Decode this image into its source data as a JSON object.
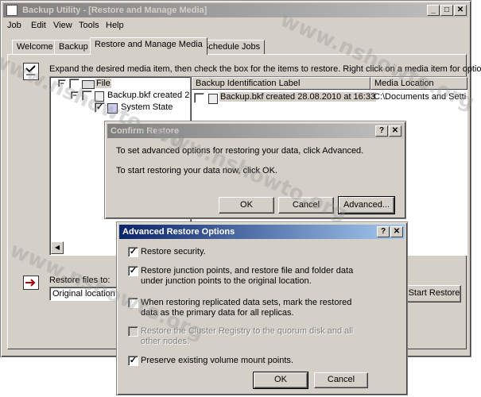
{
  "main_window": {
    "title": "Backup Utility - [Restore and Manage Media]",
    "menu": [
      "Job",
      "Edit",
      "View",
      "Tools",
      "Help"
    ],
    "tabs": [
      "Welcome",
      "Backup",
      "Restore and Manage Media",
      "Schedule Jobs"
    ],
    "instruction": "Expand the desired media item, then check the box for the items to restore. Right click on a media item for options:",
    "tree": {
      "root": "File",
      "child": "Backup.bkf created 2",
      "grandchild": "System State"
    },
    "list": {
      "columns": [
        "Backup Identification Label",
        "Media Location"
      ],
      "rows": [
        {
          "label": "Backup.bkf created 28.08.2010 at 16:33",
          "location": "C:\\Documents and Settin"
        }
      ]
    },
    "restore_files_to_label": "Restore files to:",
    "restore_files_to_value": "Original location",
    "start_restore_label": "Start Restore"
  },
  "confirm_dialog": {
    "title": "Confirm Restore",
    "line1": "To set advanced options for restoring your data, click Advanced.",
    "line2": "To start restoring your data now, click OK.",
    "ok": "OK",
    "cancel": "Cancel",
    "advanced": "Advanced..."
  },
  "advanced_dialog": {
    "title": "Advanced Restore Options",
    "options": [
      {
        "label": "Restore security.",
        "checked": true,
        "enabled": true
      },
      {
        "label": "Restore junction points, and restore file and folder data under junction points to the original location.",
        "checked": true,
        "enabled": true
      },
      {
        "label": "When restoring replicated data sets, mark the restored data as the primary data for all replicas.",
        "checked": false,
        "enabled": true
      },
      {
        "label": "Restore the Cluster Registry to the quorum disk and all other nodes.",
        "checked": false,
        "enabled": false
      },
      {
        "label": "Preserve existing volume mount points.",
        "checked": true,
        "enabled": true
      }
    ],
    "ok": "OK",
    "cancel": "Cancel"
  },
  "caption_buttons": {
    "help": "?",
    "close": "✕",
    "minimize": "_",
    "maximize": "□"
  },
  "watermark": "www.nshowto.org",
  "colors": {
    "face": "#d4d0c8",
    "active_title": "#0a246a",
    "inactive_title": "#808080"
  }
}
